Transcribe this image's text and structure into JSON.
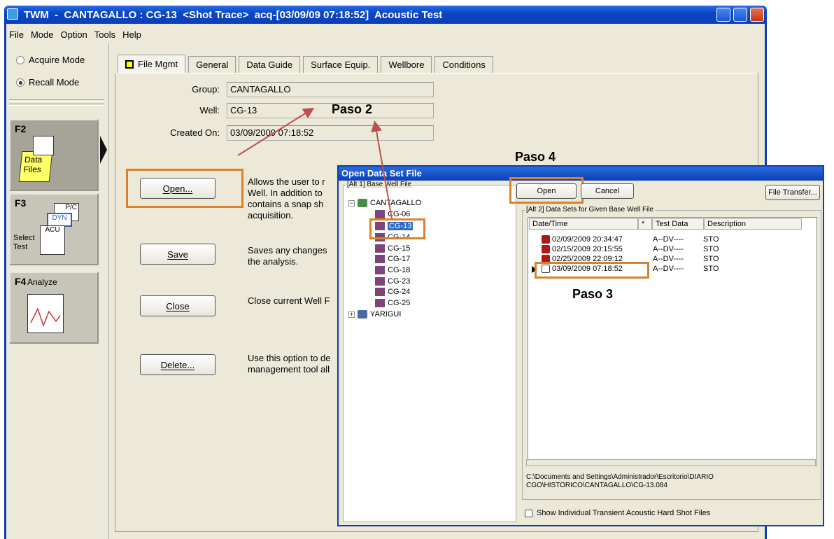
{
  "window": {
    "title": "TWM  -  CANTAGALLO : CG-13  <Shot Trace>  acq-[03/09/09 07:18:52]  Acoustic Test"
  },
  "menu": [
    "File",
    "Mode",
    "Option",
    "Tools",
    "Help"
  ],
  "left": {
    "acquire_mode": "Acquire Mode",
    "recall_mode": "Recall Mode",
    "f2": {
      "key": "F2",
      "label": "Data Files"
    },
    "f3": {
      "key": "F3",
      "label": "Select Test",
      "tag1": "P/C",
      "tag2": "DYN",
      "tag3": "ACU"
    },
    "f4": {
      "key": "F4",
      "label": "Analyze"
    }
  },
  "tabs": [
    "File Mgmt",
    "General",
    "Data Guide",
    "Surface Equip.",
    "Wellbore",
    "Conditions"
  ],
  "fields": {
    "group_label": "Group:",
    "group_value": "CANTAGALLO",
    "well_label": "Well:",
    "well_value": "CG-13",
    "created_label": "Created On:",
    "created_value": "03/09/2009  07:18:52"
  },
  "buttons": {
    "open": "Open...",
    "open_desc": "Allows the user to r\nWell.  In addition to\ncontains a snap sh\nacquisition.",
    "save": "Save",
    "save_desc": "Saves any changes\nthe analysis.",
    "close": "Close",
    "close_desc": "Close current Well F",
    "delete": "Delete...",
    "delete_desc": "Use this option to de\nmanagement tool all"
  },
  "annotations": {
    "paso2": "Paso 2",
    "paso3": "Paso 3",
    "paso4": "Paso 4"
  },
  "dialog": {
    "title": "Open Data Set File",
    "group1": "[Alt 1]  Base Well File",
    "group2": "[Alt 2]  Data Sets for Given Base Well File",
    "open": "Open",
    "cancel": "Cancel",
    "transfer": "File Transfer...",
    "tree_root": "CANTAGALLO",
    "tree": [
      "CG-06",
      "CG-13",
      "CG-14",
      "CG-15",
      "CG-17",
      "CG-18",
      "CG-23",
      "CG-24",
      "CG-25"
    ],
    "tree_root2": "YARIGUI",
    "columns": [
      "Date/Time",
      "*",
      "Test Data",
      "Description"
    ],
    "rows": [
      {
        "dt": "02/09/2009  20:34:47",
        "td": "A--DV----",
        "desc": "STO"
      },
      {
        "dt": "02/15/2009  20:15:55",
        "td": "A--DV----",
        "desc": "STO"
      },
      {
        "dt": "02/25/2009  22:09:12",
        "td": "A--DV----",
        "desc": "STO"
      },
      {
        "dt": "03/09/2009  07:18:52",
        "td": "A--DV----",
        "desc": "STO"
      }
    ],
    "path": "C:\\Documents and Settings\\Administrador\\Escritorio\\DIARIO\nCGO\\HISTORICO\\CANTAGALLO\\CG-13.084",
    "checkbox": "Show Individual Transient Acoustic Hard Shot Files"
  }
}
